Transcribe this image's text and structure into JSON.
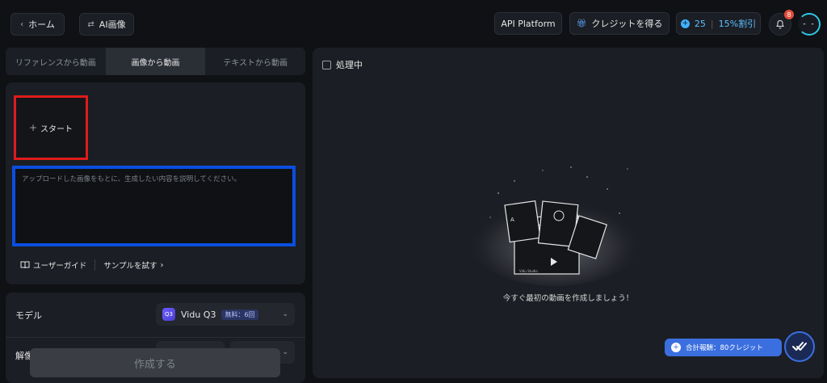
{
  "header": {
    "home_label": "ホーム",
    "ai_image_label": "AI画像",
    "api_platform_label": "API Platform",
    "get_credits_label": "クレジットを得る",
    "credits_count": "25",
    "discount_label": "15%割引",
    "notification_count": "8",
    "avatar_face": "- -"
  },
  "tabs": [
    "リファレンスから動画",
    "画像から動画",
    "テキストから動画"
  ],
  "upload": {
    "start_label": "スタート",
    "prompt_placeholder": "アップロードした画像をもとに、生成したい内容を説明してください。"
  },
  "links": {
    "user_guide": "ユーザーガイド",
    "try_sample": "サンプルを試す"
  },
  "settings": {
    "model_label": "モデル",
    "model_logo": "Q3",
    "model_name": "Vidu Q3",
    "model_badge": "無料：6回",
    "resolution_label": "解像"
  },
  "create_button": "作成する",
  "main": {
    "processing_label": "処理中",
    "illustration_text_a": "A",
    "illustration_text_b": "Vidu\nStudio",
    "empty_message": "今すぐ最初の動画を作成しましょう！"
  },
  "footer": {
    "total_cost": "合計報酬：80クレジット"
  }
}
